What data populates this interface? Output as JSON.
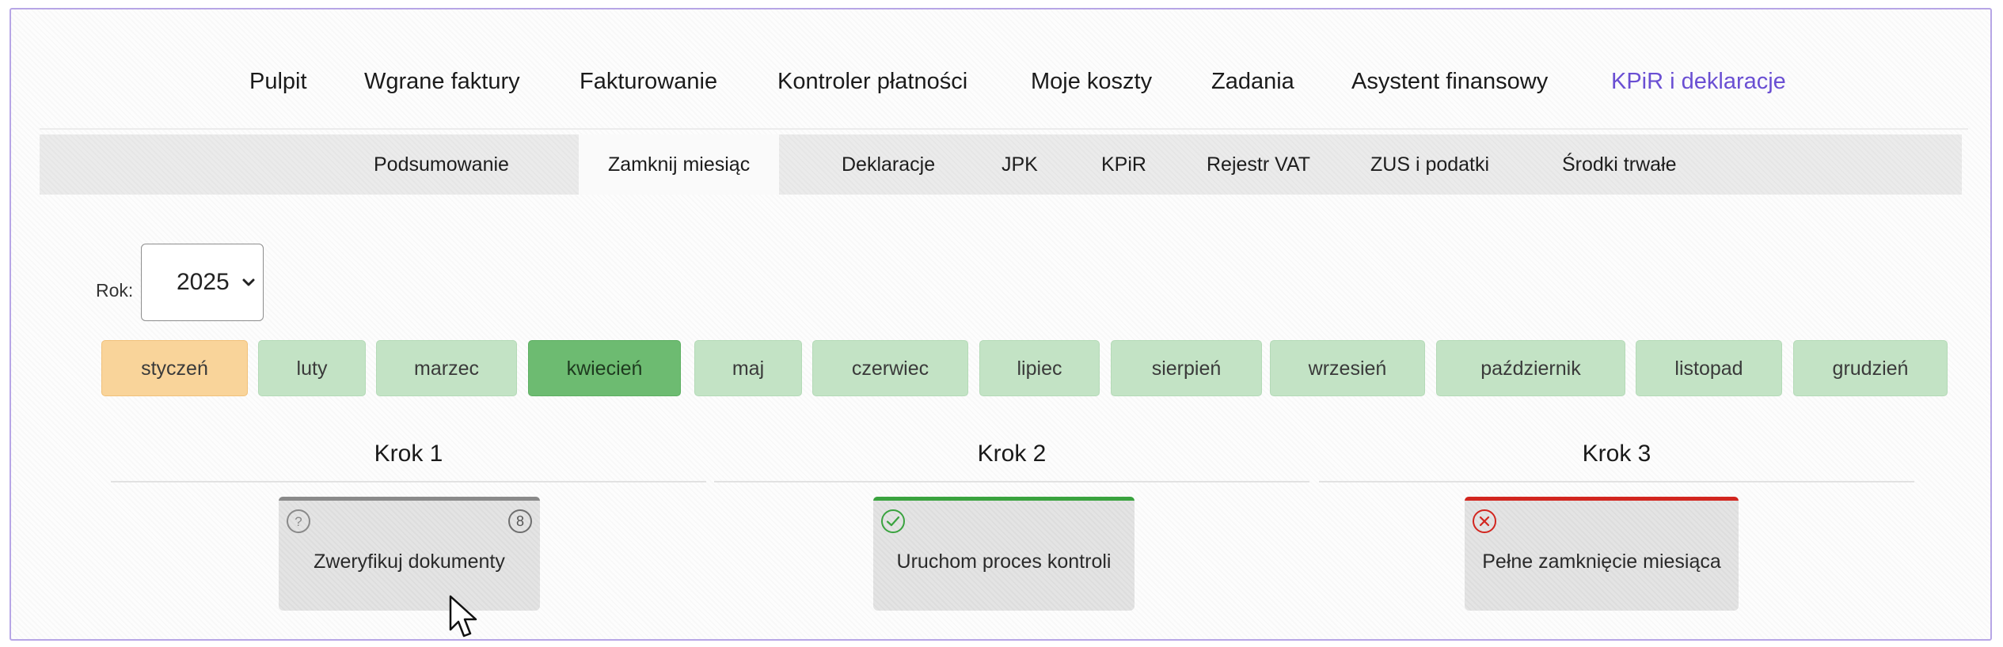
{
  "main_nav": {
    "items": [
      {
        "label": "Pulpit"
      },
      {
        "label": "Wgrane faktury"
      },
      {
        "label": "Fakturowanie"
      },
      {
        "label": "Kontroler płatności"
      },
      {
        "label": "Moje koszty"
      },
      {
        "label": "Zadania"
      },
      {
        "label": "Asystent finansowy"
      },
      {
        "label": "KPiR i deklaracje",
        "active": true
      }
    ]
  },
  "sub_nav": {
    "items": [
      {
        "label": "Podsumowanie"
      },
      {
        "label": "Zamknij miesiąc",
        "active": true
      },
      {
        "label": "Deklaracje"
      },
      {
        "label": "JPK"
      },
      {
        "label": "KPiR"
      },
      {
        "label": "Rejestr VAT"
      },
      {
        "label": "ZUS i podatki"
      },
      {
        "label": "Środki trwałe"
      }
    ]
  },
  "year": {
    "label": "Rok:",
    "value": "2025"
  },
  "months": [
    {
      "label": "styczeń",
      "state": "current"
    },
    {
      "label": "luty"
    },
    {
      "label": "marzec"
    },
    {
      "label": "kwiecień",
      "state": "selected"
    },
    {
      "label": "maj"
    },
    {
      "label": "czerwiec"
    },
    {
      "label": "lipiec"
    },
    {
      "label": "sierpień"
    },
    {
      "label": "wrzesień"
    },
    {
      "label": "październik"
    },
    {
      "label": "listopad"
    },
    {
      "label": "grudzień"
    }
  ],
  "steps": [
    {
      "title": "Krok 1",
      "card": {
        "label": "Zweryfikuj dokumenty",
        "status_icon": "question-icon",
        "badge": "8",
        "accent": "#8a8a8a"
      }
    },
    {
      "title": "Krok 2",
      "card": {
        "label": "Uruchom proces kontroli",
        "status_icon": "check-circle-icon",
        "accent": "#3aa33f"
      }
    },
    {
      "title": "Krok 3",
      "card": {
        "label": "Pełne zamknięcie miesiąca",
        "status_icon": "x-circle-icon",
        "accent": "#d2261f"
      }
    }
  ],
  "colors": {
    "accent": "#6a4fd3",
    "month_done": "#c3e3c5",
    "month_selected": "#6dbb71",
    "month_current": "#f9d49a"
  }
}
